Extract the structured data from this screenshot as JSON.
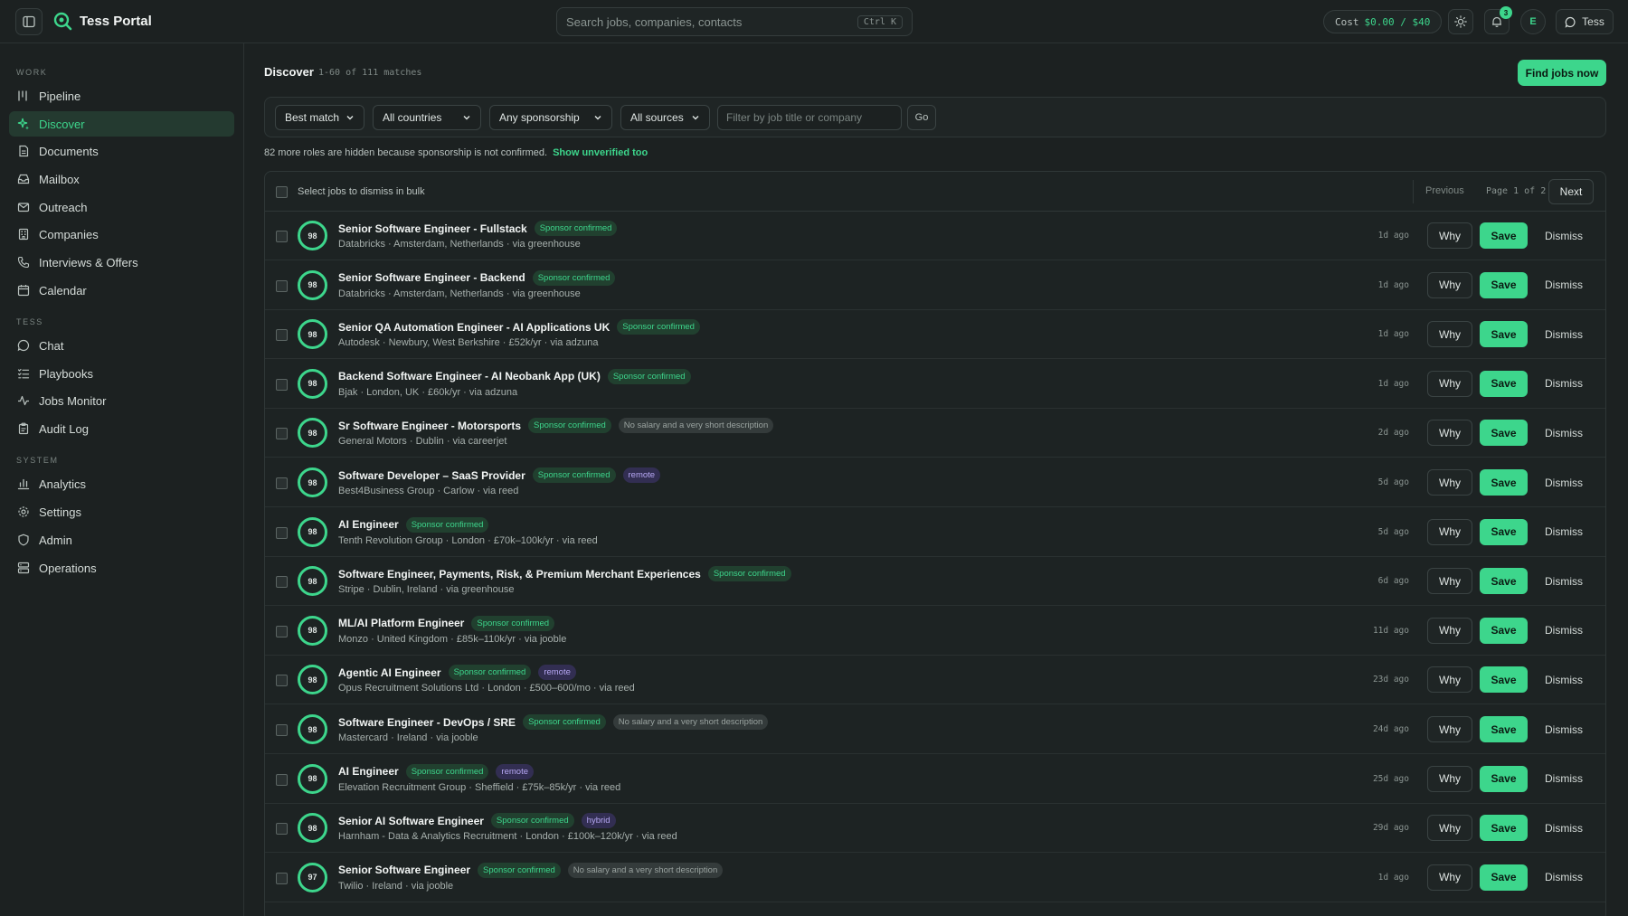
{
  "app": {
    "title": "Tess Portal",
    "search_placeholder": "Search jobs, companies, contacts",
    "search_shortcut": "Ctrl K",
    "cost_label": "Cost",
    "cost_value": "$0.00 / $40",
    "notification_count": "3",
    "avatar_initial": "E",
    "assistant_label": "Tess"
  },
  "sidebar": {
    "sections": [
      {
        "label": "WORK",
        "items": [
          "Pipeline",
          "Discover",
          "Documents",
          "Mailbox",
          "Outreach",
          "Companies",
          "Interviews & Offers",
          "Calendar"
        ]
      },
      {
        "label": "TESS",
        "items": [
          "Chat",
          "Playbooks",
          "Jobs Monitor",
          "Audit Log"
        ]
      },
      {
        "label": "SYSTEM",
        "items": [
          "Analytics",
          "Settings",
          "Admin",
          "Operations"
        ]
      }
    ],
    "active_item": "Discover"
  },
  "main": {
    "title": "Discover",
    "count": "1-60 of 111 matches",
    "find_button": "Find jobs now",
    "filters": {
      "sort": "Best match",
      "country": "All countries",
      "sponsorship": "Any sponsorship",
      "source": "All sources",
      "search_placeholder": "Filter by job title or company",
      "go": "Go"
    },
    "hidden_note": "82 more roles are hidden because sponsorship is not confirmed.",
    "show_unverified": "Show unverified too",
    "bulk_label": "Select jobs to dismiss in bulk",
    "pager": {
      "previous": "Previous",
      "page": "Page 1 of 2",
      "next": "Next"
    },
    "actions": {
      "why": "Why",
      "save": "Save",
      "dismiss": "Dismiss"
    },
    "jobs": [
      {
        "score": "98",
        "title": "Senior Software Engineer - Fullstack",
        "badges": [
          "Sponsor confirmed"
        ],
        "meta": "Databricks · Amsterdam, Netherlands · via greenhouse",
        "age": "1d ago"
      },
      {
        "score": "98",
        "title": "Senior Software Engineer - Backend",
        "badges": [
          "Sponsor confirmed"
        ],
        "meta": "Databricks · Amsterdam, Netherlands · via greenhouse",
        "age": "1d ago"
      },
      {
        "score": "98",
        "title": "Senior QA Automation Engineer - AI Applications UK",
        "badges": [
          "Sponsor confirmed"
        ],
        "meta": "Autodesk · Newbury, West Berkshire · £52k/yr · via adzuna",
        "age": "1d ago"
      },
      {
        "score": "98",
        "title": "Backend Software Engineer - AI Neobank App (UK)",
        "badges": [
          "Sponsor confirmed"
        ],
        "meta": "Bjak · London, UK · £60k/yr · via adzuna",
        "age": "1d ago"
      },
      {
        "score": "98",
        "title": "Sr Software Engineer - Motorsports",
        "badges": [
          "Sponsor confirmed",
          "No salary and a very short description"
        ],
        "meta": "General Motors · Dublin · via careerjet",
        "age": "2d ago"
      },
      {
        "score": "98",
        "title": "Software Developer – SaaS Provider",
        "badges": [
          "Sponsor confirmed",
          "remote"
        ],
        "meta": "Best4Business Group · Carlow · via reed",
        "age": "5d ago"
      },
      {
        "score": "98",
        "title": "AI Engineer",
        "badges": [
          "Sponsor confirmed"
        ],
        "meta": "Tenth Revolution Group · London · £70k–100k/yr · via reed",
        "age": "5d ago"
      },
      {
        "score": "98",
        "title": "Software Engineer, Payments, Risk, & Premium Merchant Experiences",
        "badges": [
          "Sponsor confirmed"
        ],
        "meta": "Stripe · Dublin, Ireland · via greenhouse",
        "age": "6d ago"
      },
      {
        "score": "98",
        "title": "ML/AI Platform Engineer",
        "badges": [
          "Sponsor confirmed"
        ],
        "meta": "Monzo · United Kingdom · £85k–110k/yr · via jooble",
        "age": "11d ago"
      },
      {
        "score": "98",
        "title": "Agentic AI Engineer",
        "badges": [
          "Sponsor confirmed",
          "remote"
        ],
        "meta": "Opus Recruitment Solutions Ltd · London · £500–600/mo · via reed",
        "age": "23d ago"
      },
      {
        "score": "98",
        "title": "Software Engineer - DevOps / SRE",
        "badges": [
          "Sponsor confirmed",
          "No salary and a very short description"
        ],
        "meta": "Mastercard · Ireland · via jooble",
        "age": "24d ago"
      },
      {
        "score": "98",
        "title": "AI Engineer",
        "badges": [
          "Sponsor confirmed",
          "remote"
        ],
        "meta": "Elevation Recruitment Group · Sheffield · £75k–85k/yr · via reed",
        "age": "25d ago"
      },
      {
        "score": "98",
        "title": "Senior AI Software Engineer",
        "badges": [
          "Sponsor confirmed",
          "hybrid"
        ],
        "meta": "Harnham - Data & Analytics Recruitment · London · £100k–120k/yr · via reed",
        "age": "29d ago"
      },
      {
        "score": "97",
        "title": "Senior Software Engineer",
        "badges": [
          "Sponsor confirmed",
          "No salary and a very short description"
        ],
        "meta": "Twilio · Ireland · via jooble",
        "age": "1d ago"
      }
    ]
  },
  "colors": {
    "accent": "#3dd68c",
    "background": "#1c2121"
  }
}
